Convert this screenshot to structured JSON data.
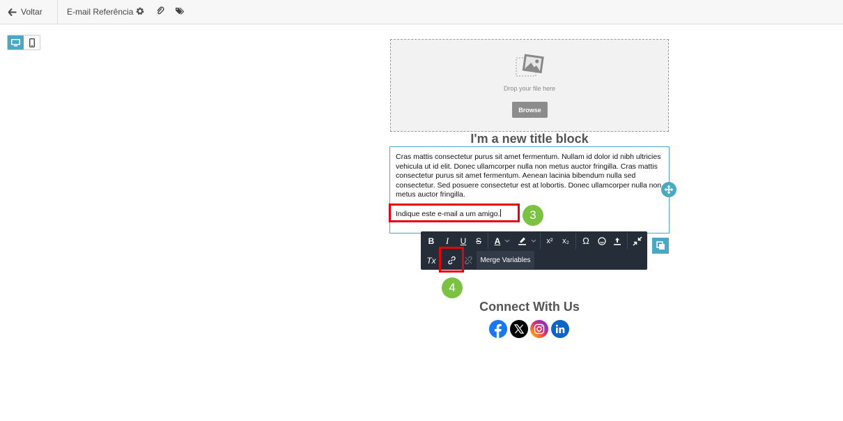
{
  "topbar": {
    "back_label": "Voltar",
    "doc_title": "E-mail Referência",
    "icons": [
      "gear-icon",
      "paperclip-icon",
      "tags-icon"
    ]
  },
  "device_toggle": {
    "options": [
      "desktop-icon",
      "mobile-icon"
    ],
    "active": "desktop"
  },
  "image_block": {
    "drop_text": "Drop your file here",
    "browse_label": "Browse"
  },
  "title_block": {
    "text": "I'm a new title block"
  },
  "text_block": {
    "body": "Cras mattis consectetur purus sit amet fermentum. Nullam id dolor id nibh ultricies vehicula ut id elit. Donec ullamcorper nulla non metus auctor fringilla. Cras mattis consectetur purus sit amet fermentum. Aenean lacinia bibendum nulla sed consectetur. Sed posuere consectetur est at lobortis. Donec ullamcorper nulla non metus auctor fringilla.",
    "link_line": "Indique este e-mail a um amigo."
  },
  "annotations": {
    "step3": "3",
    "step4": "4"
  },
  "toolbar": {
    "bold": "B",
    "italic": "I",
    "underline": "U",
    "strike": "S",
    "font_color": "A",
    "superscript": "x²",
    "subscript": "x₂",
    "special_char": "Ω",
    "clear_format": "Tx",
    "merge_variables": "Merge Variables"
  },
  "social": {
    "title": "Connect With Us",
    "icons": [
      "facebook-icon",
      "x-icon",
      "instagram-icon",
      "linkedin-icon"
    ],
    "colors": {
      "facebook": "#1877f2",
      "x": "#000000",
      "instagram": "#d6249f",
      "linkedin": "#0a66c2"
    }
  },
  "colors": {
    "accent": "#4aa8c5",
    "highlight": "#e8000a",
    "badge": "#7cc242",
    "toolbar_bg": "#252d38"
  }
}
